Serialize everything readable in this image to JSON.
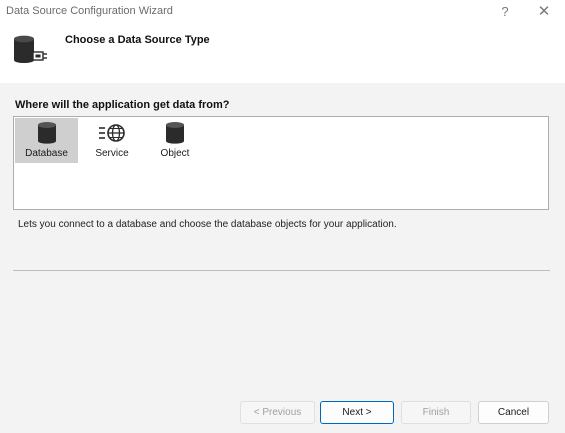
{
  "window": {
    "title": "Data Source Configuration Wizard",
    "help_glyph": "?",
    "close_glyph": "✕"
  },
  "header": {
    "title": "Choose a Data Source Type",
    "icon": "database-plug-icon"
  },
  "question": "Where will the application get data from?",
  "source_types": {
    "selected": "Database",
    "items": [
      {
        "label": "Database",
        "icon": "database-icon"
      },
      {
        "label": "Service",
        "icon": "service-globe-icon"
      },
      {
        "label": "Object",
        "icon": "object-cylinder-icon"
      }
    ]
  },
  "description": "Lets you connect to a database and choose the database objects for your application.",
  "buttons": {
    "previous": "< Previous",
    "next": "Next >",
    "finish": "Finish",
    "cancel": "Cancel"
  },
  "colors": {
    "accent": "#0067c0",
    "selection": "#cfcfcf",
    "background": "#f3f3f3"
  }
}
